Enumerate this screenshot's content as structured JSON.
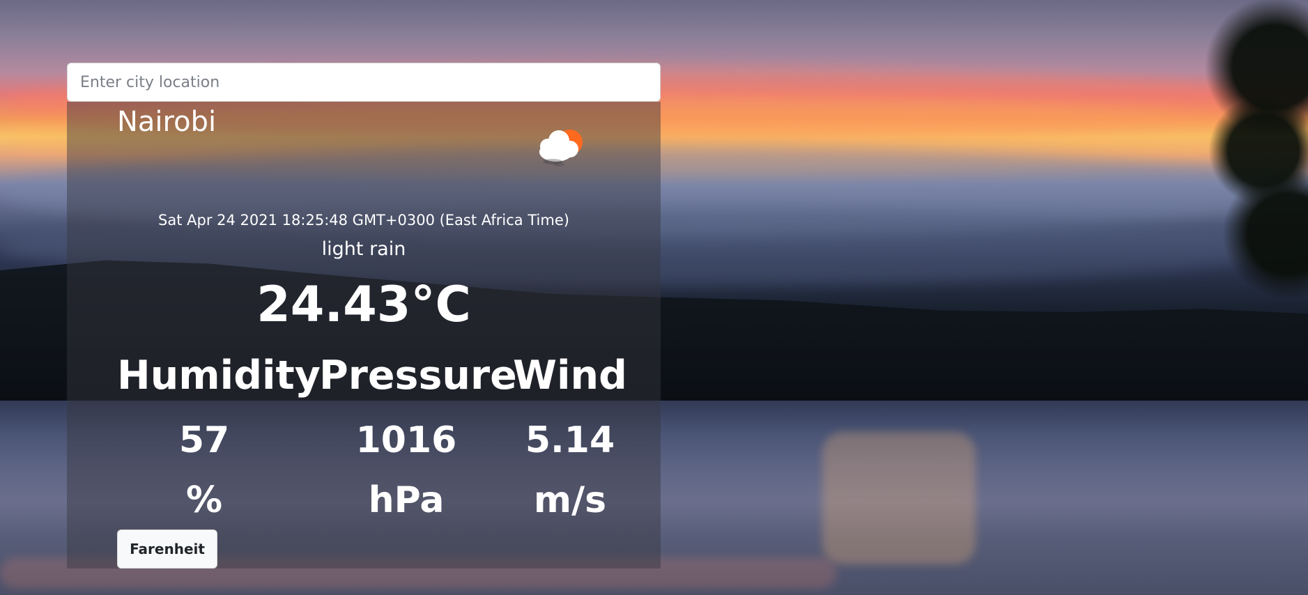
{
  "search": {
    "placeholder": "Enter city location",
    "value": ""
  },
  "weather": {
    "city": "Nairobi",
    "icon": "cloud-with-sun-icon",
    "datetime": "Sat Apr 24 2021 18:25:48 GMT+0300 (East Africa Time)",
    "description": "light rain",
    "temperature": "24.43°C"
  },
  "stats": {
    "humidity": {
      "label": "Humidity",
      "value": "57",
      "unit": "%"
    },
    "pressure": {
      "label": "Pressure",
      "value": "1016",
      "unit": "hPa"
    },
    "wind": {
      "label": "Wind",
      "value": "5.14",
      "unit": "m/s"
    }
  },
  "controls": {
    "unit_toggle_label": "Farenheit"
  },
  "colors": {
    "panel_overlay": "#383840",
    "text": "#ffffff",
    "button_bg": "#f8f9fa",
    "button_text": "#212529"
  }
}
